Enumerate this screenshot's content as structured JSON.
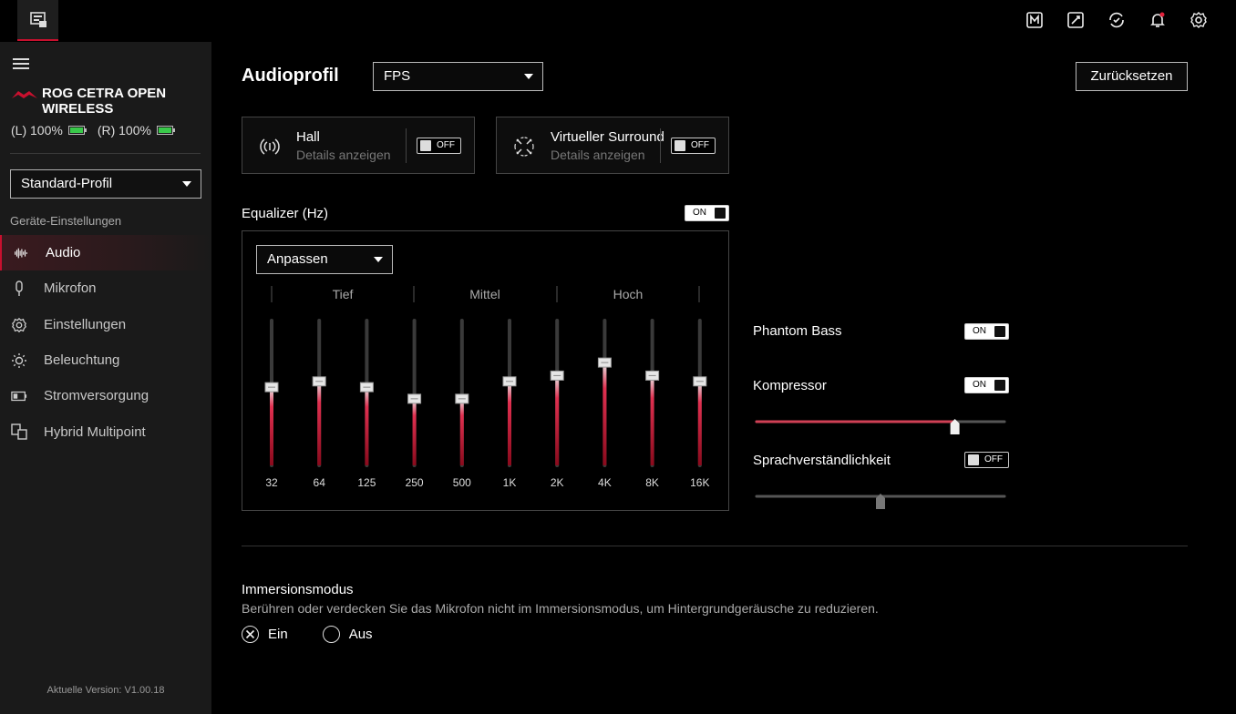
{
  "topbar": {
    "icons": [
      "device-icon",
      "macro-icon",
      "edit-icon",
      "sync-icon",
      "notification-bell-icon",
      "settings-gear-icon"
    ]
  },
  "sidebar": {
    "device_name_line1": "ROG CETRA OPEN",
    "device_name_line2": "WIRELESS",
    "battery_left": "(L) 100%",
    "battery_right": "(R) 100%",
    "profile": "Standard-Profil",
    "section_label": "Geräte-Einstellungen",
    "items": [
      {
        "label": "Audio",
        "icon": "audio-wave-icon"
      },
      {
        "label": "Mikrofon",
        "icon": "microphone-icon"
      },
      {
        "label": "Einstellungen",
        "icon": "gear-icon"
      },
      {
        "label": "Beleuchtung",
        "icon": "lighting-icon"
      },
      {
        "label": "Stromversorgung",
        "icon": "battery-icon"
      },
      {
        "label": "Hybrid Multipoint",
        "icon": "multipoint-icon"
      }
    ],
    "version": "Aktuelle Version: V1.00.18"
  },
  "main": {
    "title": "Audioprofil",
    "audio_profile": "FPS",
    "reset_label": "Zurücksetzen",
    "cards": [
      {
        "title": "Hall",
        "subtitle": "Details anzeigen",
        "toggle": "OFF"
      },
      {
        "title": "Virtueller Surround",
        "subtitle": "Details anzeigen",
        "toggle": "OFF"
      }
    ],
    "eq_title": "Equalizer (Hz)",
    "eq_toggle": "ON",
    "eq_preset": "Anpassen",
    "eq_groups": [
      "Tief",
      "Mittel",
      "Hoch"
    ],
    "eq_bands": [
      {
        "label": "32",
        "level": 0.54
      },
      {
        "label": "64",
        "level": 0.58
      },
      {
        "label": "125",
        "level": 0.54
      },
      {
        "label": "250",
        "level": 0.46
      },
      {
        "label": "500",
        "level": 0.46
      },
      {
        "label": "1K",
        "level": 0.58
      },
      {
        "label": "2K",
        "level": 0.62
      },
      {
        "label": "4K",
        "level": 0.71
      },
      {
        "label": "8K",
        "level": 0.62
      },
      {
        "label": "16K",
        "level": 0.58
      }
    ],
    "phantom_bass": {
      "label": "Phantom Bass",
      "toggle": "ON"
    },
    "kompressor": {
      "label": "Kompressor",
      "toggle": "ON",
      "level": 0.8
    },
    "sprach": {
      "label": "Sprachverständlichkeit",
      "toggle": "OFF",
      "level": 0.5
    },
    "immersion": {
      "title": "Immersionsmodus",
      "description": "Berühren oder verdecken Sie das Mikrofon nicht im Immersionsmodus, um Hintergrundgeräusche zu reduzieren.",
      "option_on": "Ein",
      "option_off": "Aus",
      "selected": "Ein"
    }
  },
  "colors": {
    "accent": "#c8102e",
    "battery": "#39c94a"
  }
}
